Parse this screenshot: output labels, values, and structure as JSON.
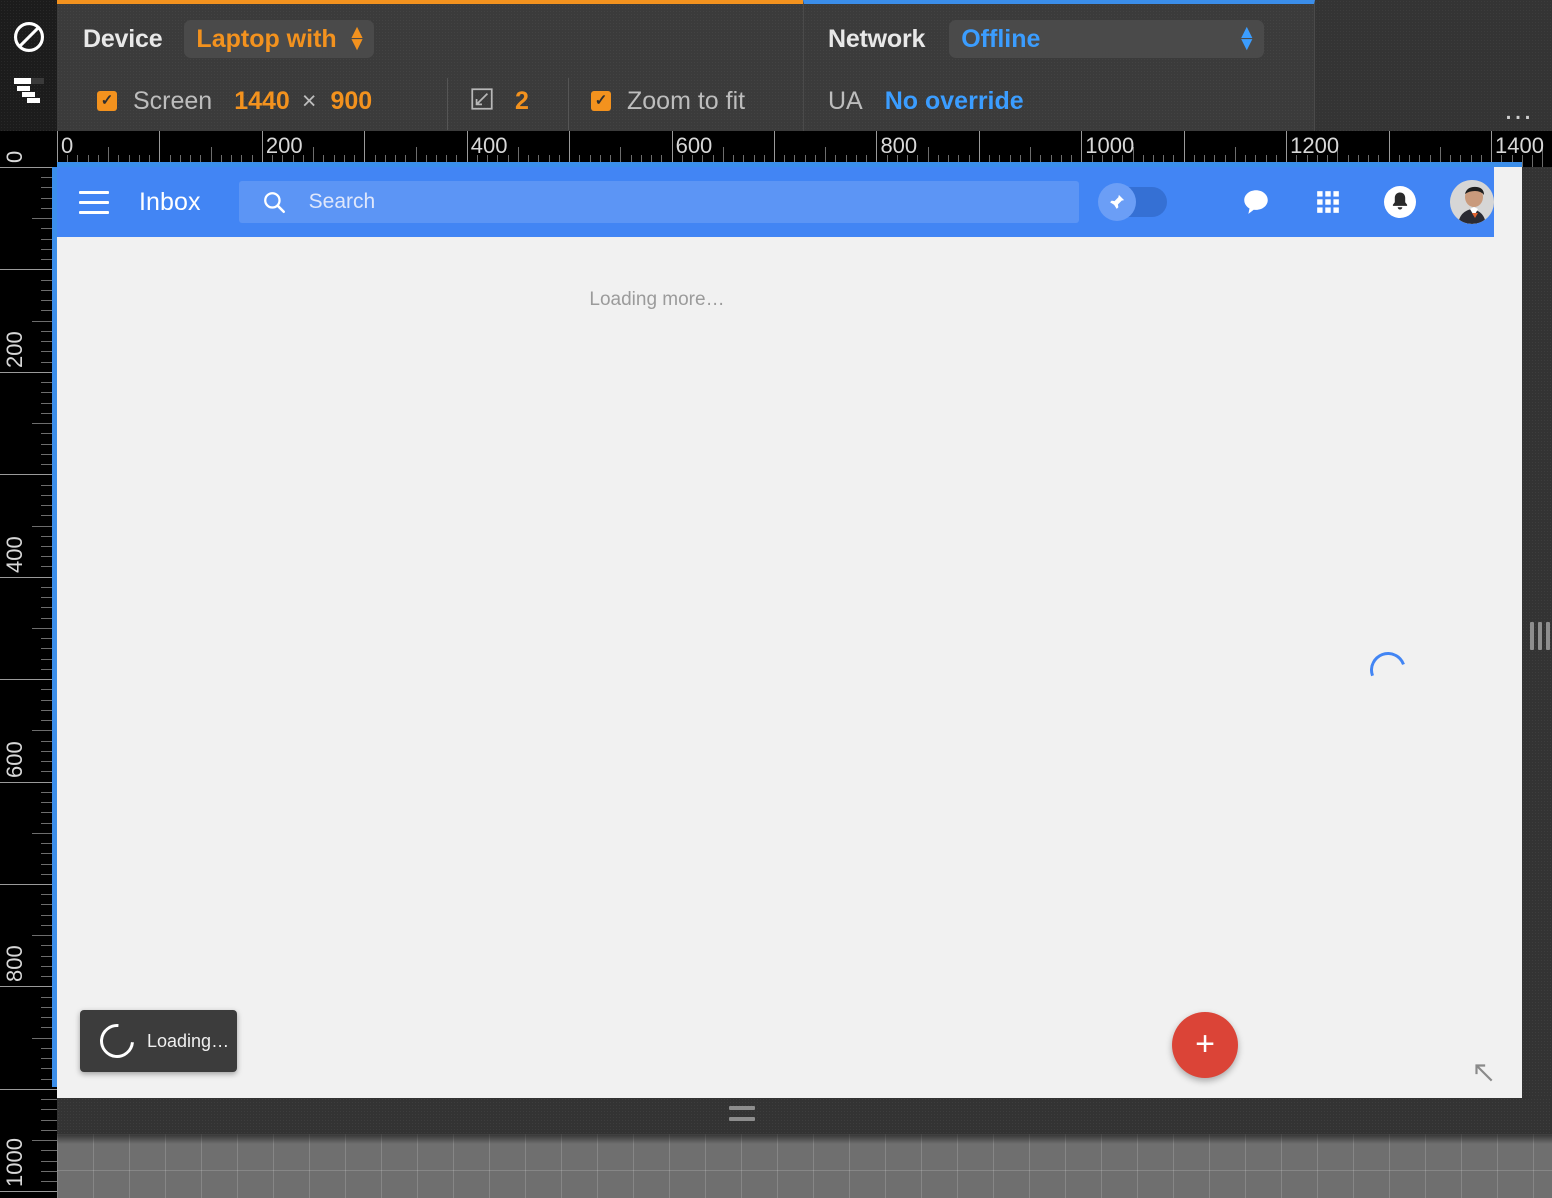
{
  "devtools": {
    "rail": {
      "block_icon": "block-icon",
      "layers_icon": "device-layers-icon"
    },
    "device_panel": {
      "device_label": "Device",
      "device_value": "Laptop with HiDPI s",
      "screen_label": "Screen",
      "screen_checked": true,
      "width": "1440",
      "times": "×",
      "height": "900",
      "dpr_icon": "dpr-icon",
      "dpr_value": "2",
      "zoom_label": "Zoom to fit",
      "zoom_checked": true
    },
    "network_panel": {
      "network_label": "Network",
      "network_value": "Offline",
      "ua_label": "UA",
      "ua_value": "No override"
    },
    "more_menu": "…",
    "accent_device": "#f3921e",
    "accent_network": "#3b8eea"
  },
  "rulers": {
    "top_labels": [
      "0",
      "200",
      "400",
      "600",
      "800",
      "1000",
      "1200",
      "1400"
    ],
    "left_labels": [
      "0",
      "200",
      "400",
      "600",
      "800",
      "1000"
    ],
    "unit_scale": 1.0243
  },
  "app": {
    "toolbar": {
      "menu_icon": "hamburger-menu-icon",
      "title": "Inbox",
      "search_icon": "search-icon",
      "search_placeholder": "Search",
      "search_value": "",
      "pin_toggle_icon": "pin-icon",
      "pin_toggle_on": true,
      "hangouts_icon": "speech-bubble-icon",
      "apps_icon": "apps-grid-icon",
      "notifications_icon": "bell-icon",
      "avatar_icon": "user-avatar",
      "background_color": "#4285f4"
    },
    "content": {
      "loading_more_text": "Loading more…",
      "spinner_icon": "loading-spinner-icon",
      "spinner_color": "#4285f4"
    },
    "toast": {
      "spinner_icon": "toast-spinner-icon",
      "text": "Loading…"
    },
    "fab": {
      "icon": "plus-icon",
      "label": "+",
      "color": "#db4437"
    },
    "resize_corner_icon": "resize-nwse-icon"
  },
  "chrome": {
    "vertical_resize_handle": "vertical-resize-handle",
    "horizontal_resize_handle": "horizontal-resize-handle"
  }
}
